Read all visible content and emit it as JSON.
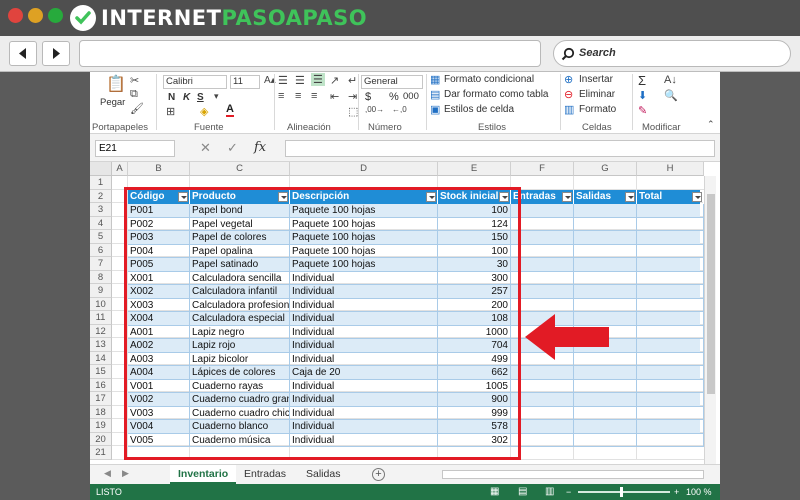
{
  "browser": {
    "logo_prefix": "INTERNET",
    "logo_accent": "PASOAPASO",
    "search_placeholder": "Search",
    "brand_green": "#3fc35a"
  },
  "ribbon": {
    "clipboard": {
      "paste_label": "Pegar",
      "group_label": "Portapapeles"
    },
    "font": {
      "font_name": "Calibri",
      "font_size": "11",
      "bold": "N",
      "italic": "K",
      "underline": "S",
      "group_label": "Fuente"
    },
    "alignment": {
      "group_label": "Alineación"
    },
    "number": {
      "format": "General",
      "currency": "$",
      "percent": "%",
      "thousands": "000",
      "group_label": "Número"
    },
    "styles": {
      "conditional": "Formato condicional",
      "as_table": "Dar formato como tabla",
      "cell_styles": "Estilos de celda",
      "group_label": "Estilos"
    },
    "cells": {
      "insert": "Insertar",
      "delete": "Eliminar",
      "format": "Formato",
      "group_label": "Celdas"
    },
    "editing": {
      "sum_icon": "Σ",
      "group_label": "Modificar"
    }
  },
  "formula_bar": {
    "name_box": "E21",
    "fx_label": "fx",
    "formula": ""
  },
  "columns": [
    "A",
    "B",
    "C",
    "D",
    "E",
    "F",
    "G",
    "H"
  ],
  "rows": [
    "1",
    "2",
    "3",
    "4",
    "5",
    "6",
    "7",
    "8",
    "9",
    "10",
    "11",
    "12",
    "13",
    "14",
    "15",
    "16",
    "17",
    "18",
    "19",
    "20",
    "21"
  ],
  "table": {
    "headers": [
      "Código",
      "Producto",
      "Descripción",
      "Stock inicial",
      "Entradas",
      "Salidas",
      "Total"
    ],
    "rows": [
      [
        "P001",
        "Papel bond",
        "Paquete 100 hojas",
        "100"
      ],
      [
        "P002",
        "Papel vegetal",
        "Paquete 100 hojas",
        "124"
      ],
      [
        "P003",
        "Papel de colores",
        "Paquete 100 hojas",
        "150"
      ],
      [
        "P004",
        "Papel opalina",
        "Paquete 100 hojas",
        "100"
      ],
      [
        "P005",
        "Papel satinado",
        "Paquete 100 hojas",
        "30"
      ],
      [
        "X001",
        "Calculadora sencilla",
        "Individual",
        "300"
      ],
      [
        "X002",
        "Calculadora infantil",
        "Individual",
        "257"
      ],
      [
        "X003",
        "Calculadora profesional",
        "Individual",
        "200"
      ],
      [
        "X004",
        "Calculadora especial",
        "Individual",
        "108"
      ],
      [
        "A001",
        "Lapiz negro",
        "Individual",
        "1000"
      ],
      [
        "A002",
        "Lapiz rojo",
        "Individual",
        "704"
      ],
      [
        "A003",
        "Lapiz bicolor",
        "Individual",
        "499"
      ],
      [
        "A004",
        "Lápices de colores",
        "Caja de 20",
        "662"
      ],
      [
        "V001",
        "Cuaderno rayas",
        "Individual",
        "1005"
      ],
      [
        "V002",
        "Cuaderno cuadro grande",
        "Individual",
        "900"
      ],
      [
        "V003",
        "Cuaderno cuadro chico",
        "Individual",
        "999"
      ],
      [
        "V004",
        "Cuaderno blanco",
        "Individual",
        "578"
      ],
      [
        "V005",
        "Cuaderno música",
        "Individual",
        "302"
      ]
    ]
  },
  "sheets": [
    "Inventario",
    "Entradas",
    "Salidas"
  ],
  "active_sheet": "Inventario",
  "status": {
    "mode": "LISTO",
    "zoom": "100 %"
  },
  "colors": {
    "table_header": "#1f8dd6",
    "band": "#dcebf7",
    "highlight": "#e21b25",
    "excel_green": "#217346"
  }
}
